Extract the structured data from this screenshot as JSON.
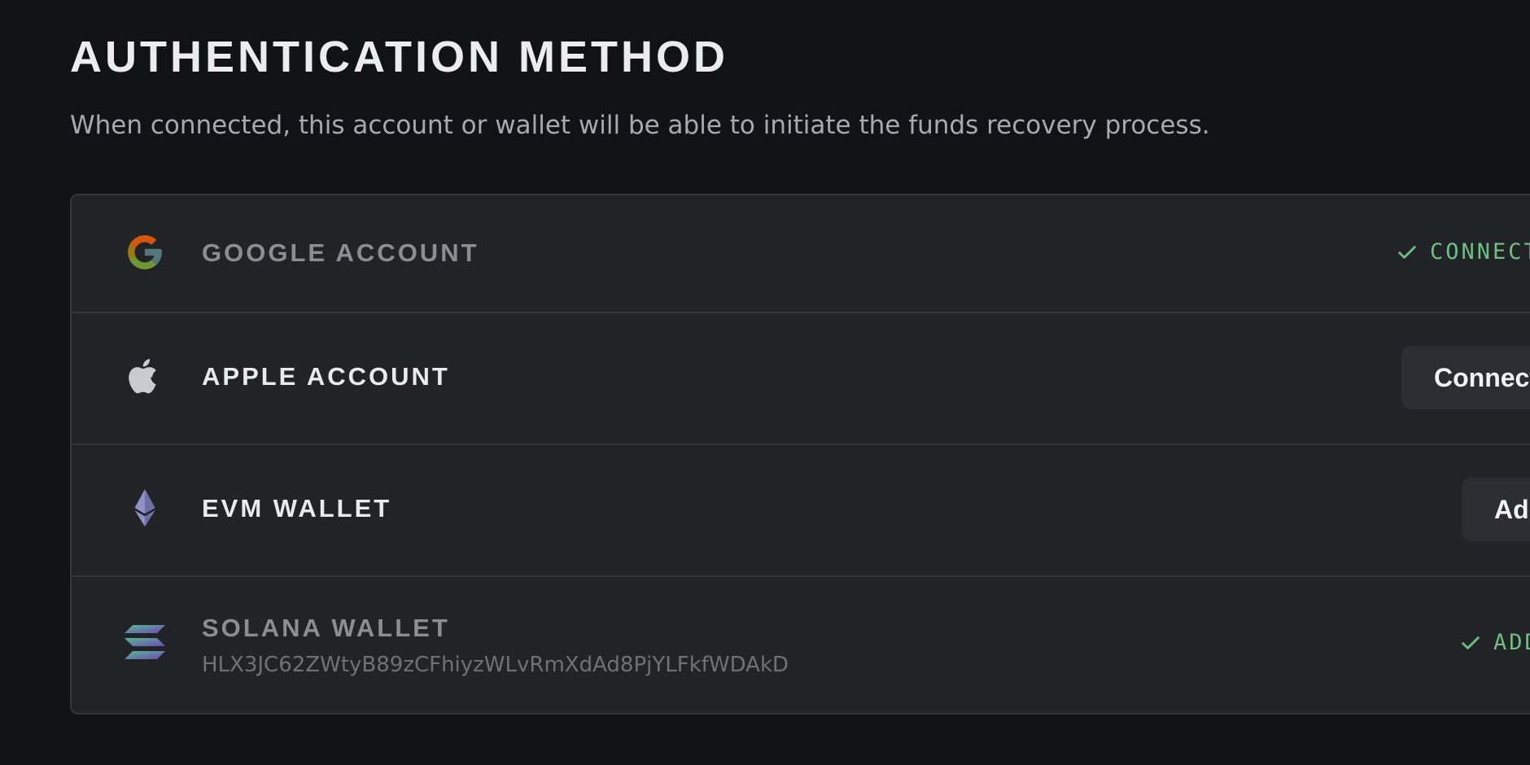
{
  "header": {
    "title": "AUTHENTICATION METHOD",
    "subtitle": "When connected, this account or wallet will be able to initiate the funds recovery process."
  },
  "methods": [
    {
      "label": "GOOGLE ACCOUNT",
      "icon": "google-icon",
      "status": "CONNECTED",
      "status_icon": "check-icon"
    },
    {
      "label": "APPLE ACCOUNT",
      "icon": "apple-icon",
      "action_label": "Connect"
    },
    {
      "label": "EVM WALLET",
      "icon": "ethereum-icon",
      "action_label": "Add"
    },
    {
      "label": "SOLANA WALLET",
      "icon": "solana-icon",
      "address": "HLX3JC62ZWtyB89zCFhiyzWLvRmXdAd8PjYLFkfWDAkD",
      "status": "ADDED",
      "status_icon": "check-icon"
    }
  ],
  "colors": {
    "background": "#111216",
    "card": "#222327",
    "border": "#35363b",
    "success": "#6fbf83",
    "button": "#2c2d32"
  }
}
